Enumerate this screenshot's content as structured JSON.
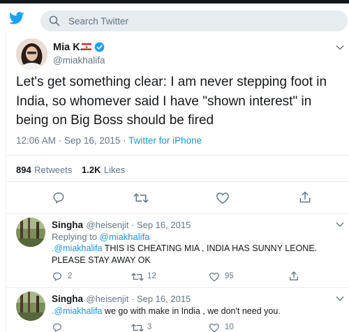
{
  "search": {
    "placeholder": "Search Twitter"
  },
  "tweet": {
    "author_name": "Mia K.",
    "handle": "@miakhalifa",
    "text": "Let's get something clear: I am never stepping foot in India, so whomever said I have \"shown interest\" in being on Big Boss should be fired",
    "time": "12:06 AM",
    "date_sep": " · ",
    "date": "Sep 16, 2015",
    "source_sep": " · ",
    "source": "Twitter for iPhone",
    "retweets_count": "894",
    "retweets_label": "Retweets",
    "likes_count": "1.2K",
    "likes_label": "Likes",
    "icons": [
      "reply-icon",
      "retweet-icon",
      "like-icon",
      "share-icon"
    ],
    "colors": {
      "link": "#1b95e0",
      "muted": "#657786",
      "verified": "#1da1f2",
      "flag_red": "#e0242a"
    }
  },
  "replies": [
    {
      "name": "Singha",
      "handle": "@heisenjit",
      "sep": " · ",
      "date": "Sep 16, 2015",
      "replying_prefix": "Replying to ",
      "replying_to": "@miakhalifa",
      "mention": ".@miakhalifa",
      "text": " THIS IS CHEATING MIA , INDIA HAS SUNNY LEONE. PLEASE STAY AWAY OK",
      "reply_count": "2",
      "retweet_count": "12",
      "like_count": "95"
    },
    {
      "name": "Singha",
      "handle": "@heisenjit",
      "sep": " · ",
      "date": "Sep 16, 2015",
      "mention": ".@miakhalifa",
      "text": " we go with make in India , we don't need you.",
      "reply_count": "",
      "retweet_count": "3",
      "like_count": "10"
    }
  ]
}
